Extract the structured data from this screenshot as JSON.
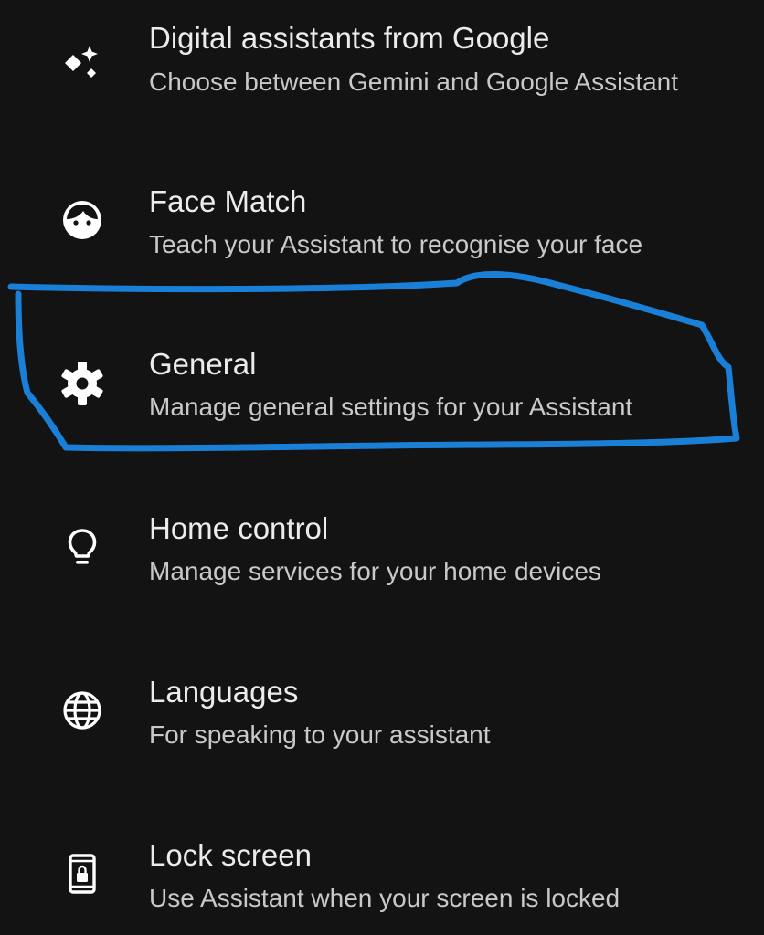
{
  "settings": {
    "items": [
      {
        "title": "Digital assistants from Google",
        "subtitle": "Choose between Gemini and Google Assistant",
        "icon": "sparkle-icon"
      },
      {
        "title": "Face Match",
        "subtitle": "Teach your Assistant to recognise your face",
        "icon": "face-icon"
      },
      {
        "title": "General",
        "subtitle": "Manage general settings for your Assistant",
        "icon": "gear-icon"
      },
      {
        "title": "Home control",
        "subtitle": "Manage services for your home devices",
        "icon": "lightbulb-icon"
      },
      {
        "title": "Languages",
        "subtitle": "For speaking to your assistant",
        "icon": "globe-icon"
      },
      {
        "title": "Lock screen",
        "subtitle": "Use Assistant when your screen is locked",
        "icon": "lock-screen-icon"
      }
    ]
  },
  "colors": {
    "background": "#131313",
    "text_primary": "#ececec",
    "text_secondary": "#c9c9c9",
    "annotation": "#1a7fd6"
  }
}
